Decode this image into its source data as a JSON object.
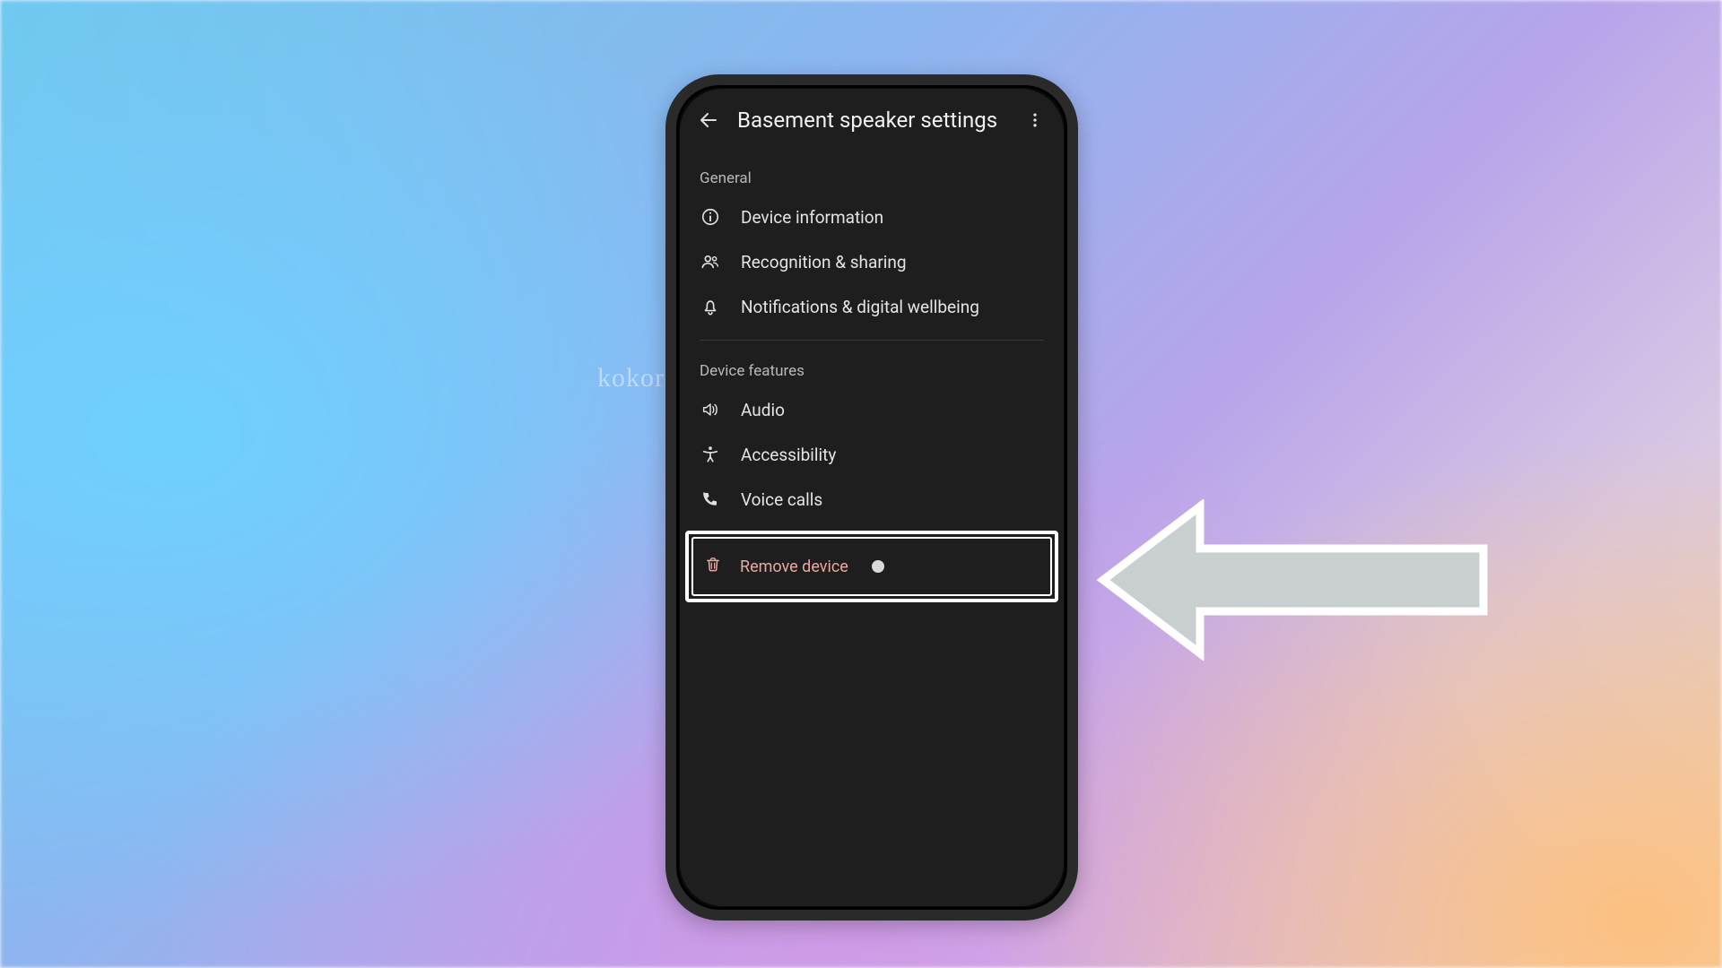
{
  "watermark": "kokord.com",
  "header": {
    "title": "Basement speaker settings"
  },
  "sections": {
    "general_label": "General",
    "general_items": {
      "device_info": "Device information",
      "recognition": "Recognition & sharing",
      "notifications": "Notifications & digital wellbeing"
    },
    "features_label": "Device features",
    "features_items": {
      "audio": "Audio",
      "accessibility": "Accessibility",
      "voice_calls": "Voice calls"
    },
    "remove_label": "Remove device"
  },
  "colors": {
    "remove_text": "#e9a8a0",
    "screen_bg": "#1e1e1e"
  },
  "icons": {
    "back": "back-arrow-icon",
    "menu": "more-vert-icon",
    "info": "info-icon",
    "people": "people-icon",
    "bell": "bell-icon",
    "volume": "volume-icon",
    "accessibility": "accessibility-icon",
    "phone": "phone-icon",
    "trash": "trash-icon"
  }
}
